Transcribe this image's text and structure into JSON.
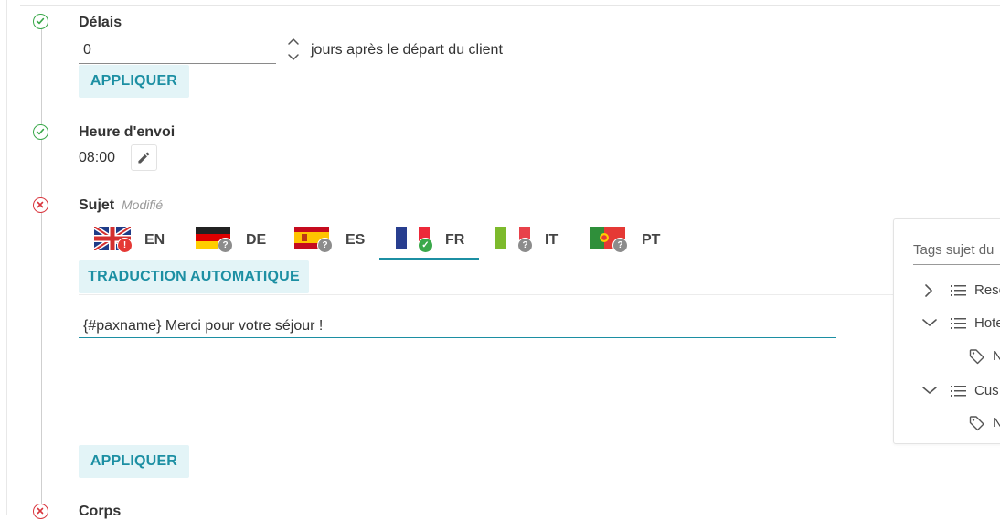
{
  "delais": {
    "title": "Délais",
    "value": "0",
    "suffix": "jours après le départ du client",
    "apply_label": "APPLIQUER"
  },
  "heure_envoi": {
    "title": "Heure d'envoi",
    "value": "08:00"
  },
  "sujet": {
    "title": "Sujet",
    "modified_label": "Modifié",
    "tabs": [
      {
        "code": "EN",
        "status": "!"
      },
      {
        "code": "DE",
        "status": "?"
      },
      {
        "code": "ES",
        "status": "?"
      },
      {
        "code": "FR",
        "status": "✓"
      },
      {
        "code": "IT",
        "status": "?"
      },
      {
        "code": "PT",
        "status": "?"
      }
    ],
    "auto_translate_label": "TRADUCTION AUTOMATIQUE",
    "subject_text": "{#paxname} Merci pour votre séjour !",
    "apply_label": "APPLIQUER"
  },
  "corps": {
    "title": "Corps"
  },
  "tags_panel": {
    "search_label": "Tags sujet du",
    "tree": [
      {
        "label": "Rese"
      },
      {
        "label": "Hote"
      },
      {
        "label": "N"
      },
      {
        "label": "Cus"
      },
      {
        "label": "N"
      }
    ]
  },
  "colors": {
    "accent": "#1c8fa3",
    "success": "#3aa84a",
    "error": "#d9363e"
  }
}
